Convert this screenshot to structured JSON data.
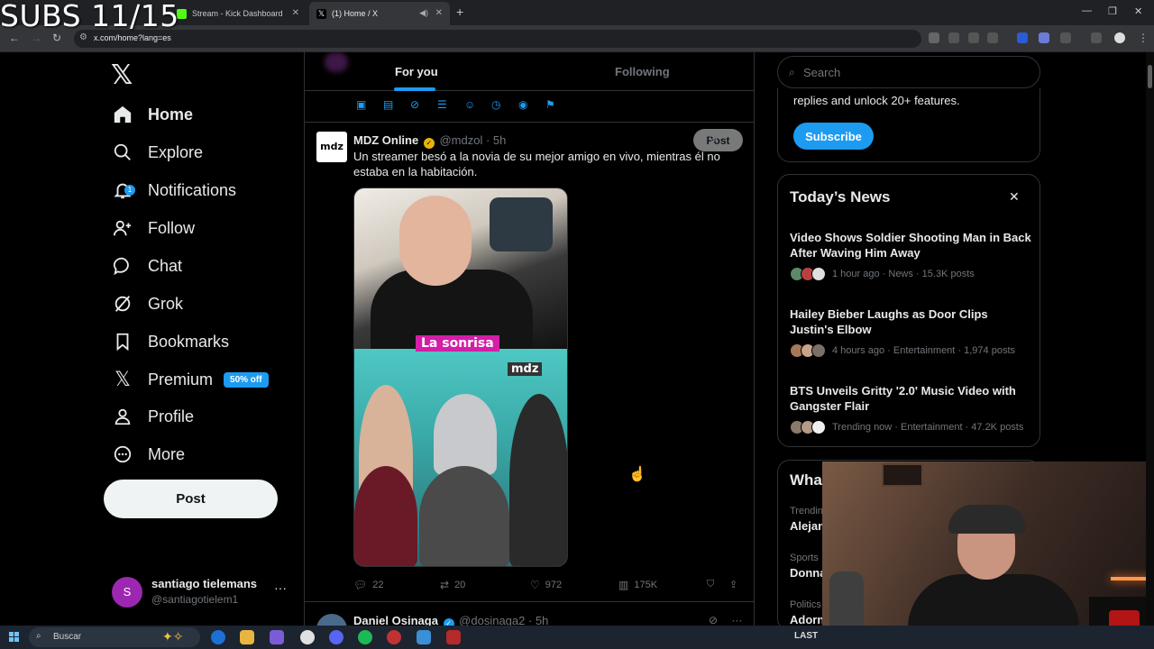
{
  "overlay": {
    "subs": "SUBS 11/15"
  },
  "browser": {
    "tabs": [
      {
        "label": "Stream - Kick Dashboard"
      },
      {
        "label": "(1) Home / X"
      }
    ],
    "url": "x.com/home?lang=es"
  },
  "nav": {
    "items": [
      {
        "label": "Home",
        "icon": "home-icon"
      },
      {
        "label": "Explore",
        "icon": "search-icon"
      },
      {
        "label": "Notifications",
        "icon": "bell-icon",
        "badge": "1"
      },
      {
        "label": "Follow",
        "icon": "follow-icon"
      },
      {
        "label": "Chat",
        "icon": "chat-icon"
      },
      {
        "label": "Grok",
        "icon": "grok-icon"
      },
      {
        "label": "Bookmarks",
        "icon": "bookmark-icon"
      },
      {
        "label": "Premium",
        "icon": "x-icon",
        "badge": "50% off"
      },
      {
        "label": "Profile",
        "icon": "person-icon"
      },
      {
        "label": "More",
        "icon": "more-circle-icon"
      }
    ],
    "post_label": "Post",
    "user": {
      "initial": "S",
      "name": "santiago tielemans",
      "handle": "@santiagotielem1"
    }
  },
  "timeline": {
    "tabs": [
      {
        "label": "For you"
      },
      {
        "label": "Following"
      }
    ],
    "compose_post_label": "Post",
    "tweet": {
      "avatar_text": "mdz",
      "name": "MDZ Online",
      "handle": "@mdzol",
      "time": "5h",
      "text": "Un streamer besó a la novia de su mejor amigo en vivo, mientras él no estaba en la habitación.",
      "media_caption": "La sonrisa",
      "media_logo": "mdz",
      "replies": "22",
      "reposts": "20",
      "likes": "972",
      "views": "175K"
    },
    "tweet2": {
      "name": "Daniel Osinaga",
      "handle": "@dosinaga2",
      "time": "5h"
    }
  },
  "sidebar": {
    "search_placeholder": "Search",
    "premium_text": "replies and unlock 20+ features.",
    "subscribe_label": "Subscribe",
    "news": {
      "title": "Today’s News",
      "items": [
        {
          "headline": "Video Shows Soldier Shooting Man in Back After Waving Him Away",
          "meta": "1 hour ago · News · 15.3K posts"
        },
        {
          "headline": "Hailey Bieber Laughs as Door Clips Justin's Elbow",
          "meta": "4 hours ago · Entertainment · 1,974 posts"
        },
        {
          "headline": "BTS Unveils Gritty '2.0' Music Video with Gangster Flair",
          "meta": "Trending now · Entertainment · 47.2K posts"
        }
      ]
    },
    "whats": {
      "title": "Wha",
      "trends": [
        {
          "category": "Trendin",
          "name": "Alejan"
        },
        {
          "category": "Sports",
          "name": "Donna"
        },
        {
          "category": "Politics",
          "name": "Adorn"
        }
      ]
    }
  },
  "taskbar": {
    "search_label": "Buscar",
    "last_label": "LAST"
  }
}
